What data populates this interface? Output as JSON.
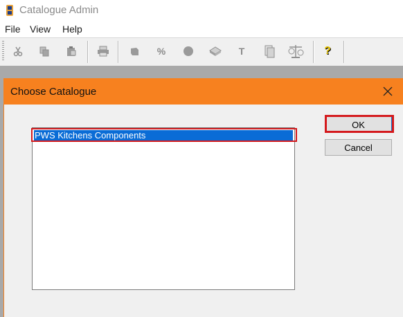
{
  "app": {
    "title": "Catalogue Admin",
    "icon": "catalogue-app-icon"
  },
  "menu": {
    "items": [
      {
        "label": "File"
      },
      {
        "label": "View"
      },
      {
        "label": "Help"
      }
    ]
  },
  "toolbar": {
    "buttons": [
      {
        "icon": "cut-icon",
        "enabled": false
      },
      {
        "icon": "copy-icon",
        "enabled": false
      },
      {
        "icon": "paste-icon",
        "enabled": false
      },
      {
        "icon": "print-icon",
        "enabled": false
      },
      {
        "icon": "cube-icon",
        "enabled": false
      },
      {
        "icon": "percent-icon",
        "enabled": false
      },
      {
        "icon": "circle-icon",
        "enabled": false
      },
      {
        "icon": "book-icon",
        "enabled": false
      },
      {
        "icon": "text-icon",
        "enabled": false
      },
      {
        "icon": "documents-icon",
        "enabled": false
      },
      {
        "icon": "scales-icon",
        "enabled": false
      },
      {
        "icon": "help-icon",
        "enabled": true
      }
    ],
    "percent_label": "%",
    "text_label": "T",
    "help_label": "?"
  },
  "dialog": {
    "title": "Choose Catalogue",
    "list": {
      "items": [
        "PWS Kitchens Components"
      ],
      "selected_index": 0
    },
    "ok_label": "OK",
    "cancel_label": "Cancel"
  },
  "colors": {
    "dialog_titlebar": "#f7811f",
    "selection": "#0a6cd6",
    "highlight_annotation": "#d4191c",
    "mdi_background": "#a9a9a9"
  }
}
